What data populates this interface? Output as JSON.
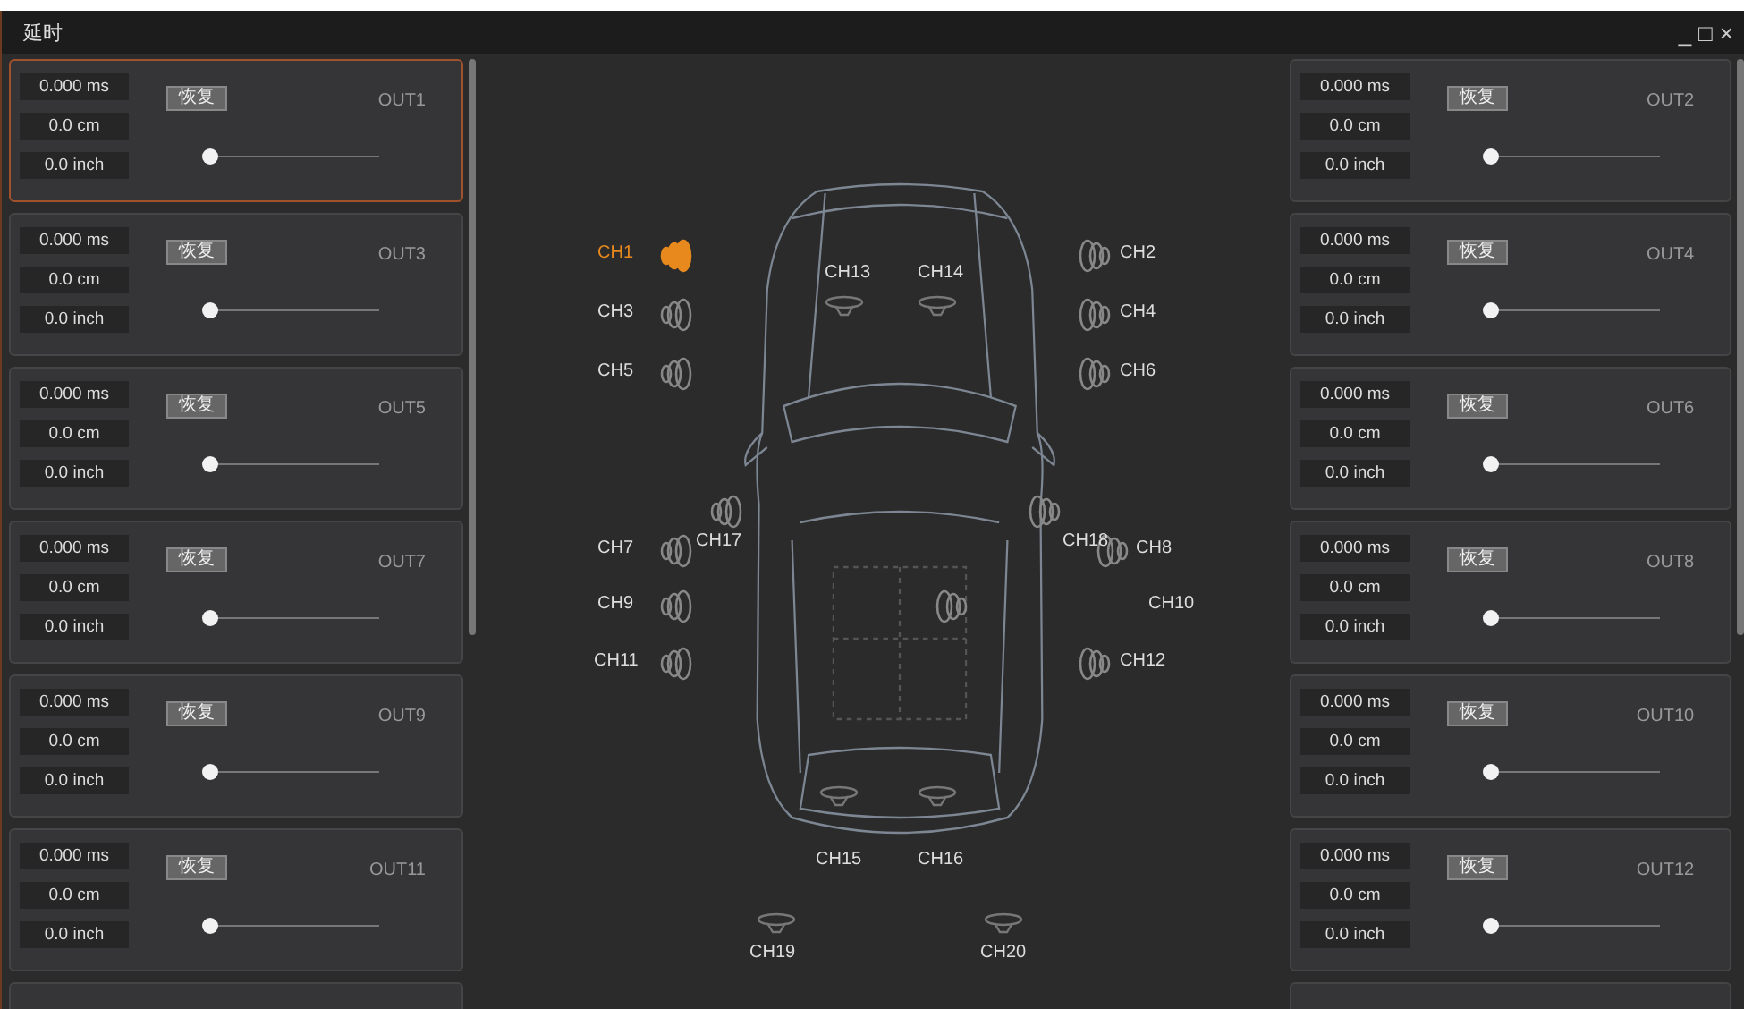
{
  "window": {
    "title": "延时",
    "controls": [
      "_",
      "□",
      "×"
    ]
  },
  "left_outputs": [
    {
      "ms": "0.000 ms",
      "cm": "0.0 cm",
      "inch": "0.0 inch",
      "button": "恢复",
      "label": "OUT1",
      "selected": true,
      "level": 0
    },
    {
      "ms": "0.000 ms",
      "cm": "0.0 cm",
      "inch": "0.0 inch",
      "button": "恢复",
      "label": "OUT3",
      "selected": false,
      "level": 0
    },
    {
      "ms": "0.000 ms",
      "cm": "0.0 cm",
      "inch": "0.0 inch",
      "button": "恢复",
      "label": "OUT5",
      "selected": false,
      "level": 0
    },
    {
      "ms": "0.000 ms",
      "cm": "0.0 cm",
      "inch": "0.0 inch",
      "button": "恢复",
      "label": "OUT7",
      "selected": false,
      "level": 0
    },
    {
      "ms": "0.000 ms",
      "cm": "0.0 cm",
      "inch": "0.0 inch",
      "button": "恢复",
      "label": "OUT9",
      "selected": false,
      "level": 0
    },
    {
      "ms": "0.000 ms",
      "cm": "0.0 cm",
      "inch": "0.0 inch",
      "button": "恢复",
      "label": "OUT11",
      "selected": false,
      "level": 0
    }
  ],
  "right_outputs": [
    {
      "ms": "0.000 ms",
      "cm": "0.0 cm",
      "inch": "0.0 inch",
      "button": "恢复",
      "label": "OUT2",
      "selected": false,
      "level": 0
    },
    {
      "ms": "0.000 ms",
      "cm": "0.0 cm",
      "inch": "0.0 inch",
      "button": "恢复",
      "label": "OUT4",
      "selected": false,
      "level": 0
    },
    {
      "ms": "0.000 ms",
      "cm": "0.0 cm",
      "inch": "0.0 inch",
      "button": "恢复",
      "label": "OUT6",
      "selected": false,
      "level": 0
    },
    {
      "ms": "0.000 ms",
      "cm": "0.0 cm",
      "inch": "0.0 inch",
      "button": "恢复",
      "label": "OUT8",
      "selected": false,
      "level": 0
    },
    {
      "ms": "0.000 ms",
      "cm": "0.0 cm",
      "inch": "0.0 inch",
      "button": "恢复",
      "label": "OUT10",
      "selected": false,
      "level": 0
    },
    {
      "ms": "0.000 ms",
      "cm": "0.0 cm",
      "inch": "0.0 inch",
      "button": "恢复",
      "label": "OUT12",
      "selected": false,
      "level": 0
    }
  ],
  "channels": [
    {
      "label": "CH1",
      "kind": "side",
      "selected": true
    },
    {
      "label": "CH2",
      "kind": "side",
      "selected": false
    },
    {
      "label": "CH3",
      "kind": "side",
      "selected": false
    },
    {
      "label": "CH4",
      "kind": "side",
      "selected": false
    },
    {
      "label": "CH5",
      "kind": "side",
      "selected": false
    },
    {
      "label": "CH6",
      "kind": "side",
      "selected": false
    },
    {
      "label": "CH7",
      "kind": "side",
      "selected": false
    },
    {
      "label": "CH8",
      "kind": "side",
      "selected": false
    },
    {
      "label": "CH9",
      "kind": "side",
      "selected": false
    },
    {
      "label": "CH10",
      "kind": "side",
      "selected": false
    },
    {
      "label": "CH11",
      "kind": "side",
      "selected": false
    },
    {
      "label": "CH12",
      "kind": "side",
      "selected": false
    },
    {
      "label": "CH13",
      "kind": "dome",
      "selected": false
    },
    {
      "label": "CH14",
      "kind": "dome",
      "selected": false
    },
    {
      "label": "CH15",
      "kind": "dome",
      "selected": false
    },
    {
      "label": "CH16",
      "kind": "dome",
      "selected": false
    },
    {
      "label": "CH17",
      "kind": "side",
      "selected": false
    },
    {
      "label": "CH18",
      "kind": "side",
      "selected": false
    },
    {
      "label": "CH19",
      "kind": "dome",
      "selected": false
    },
    {
      "label": "CH20",
      "kind": "dome",
      "selected": false
    }
  ]
}
